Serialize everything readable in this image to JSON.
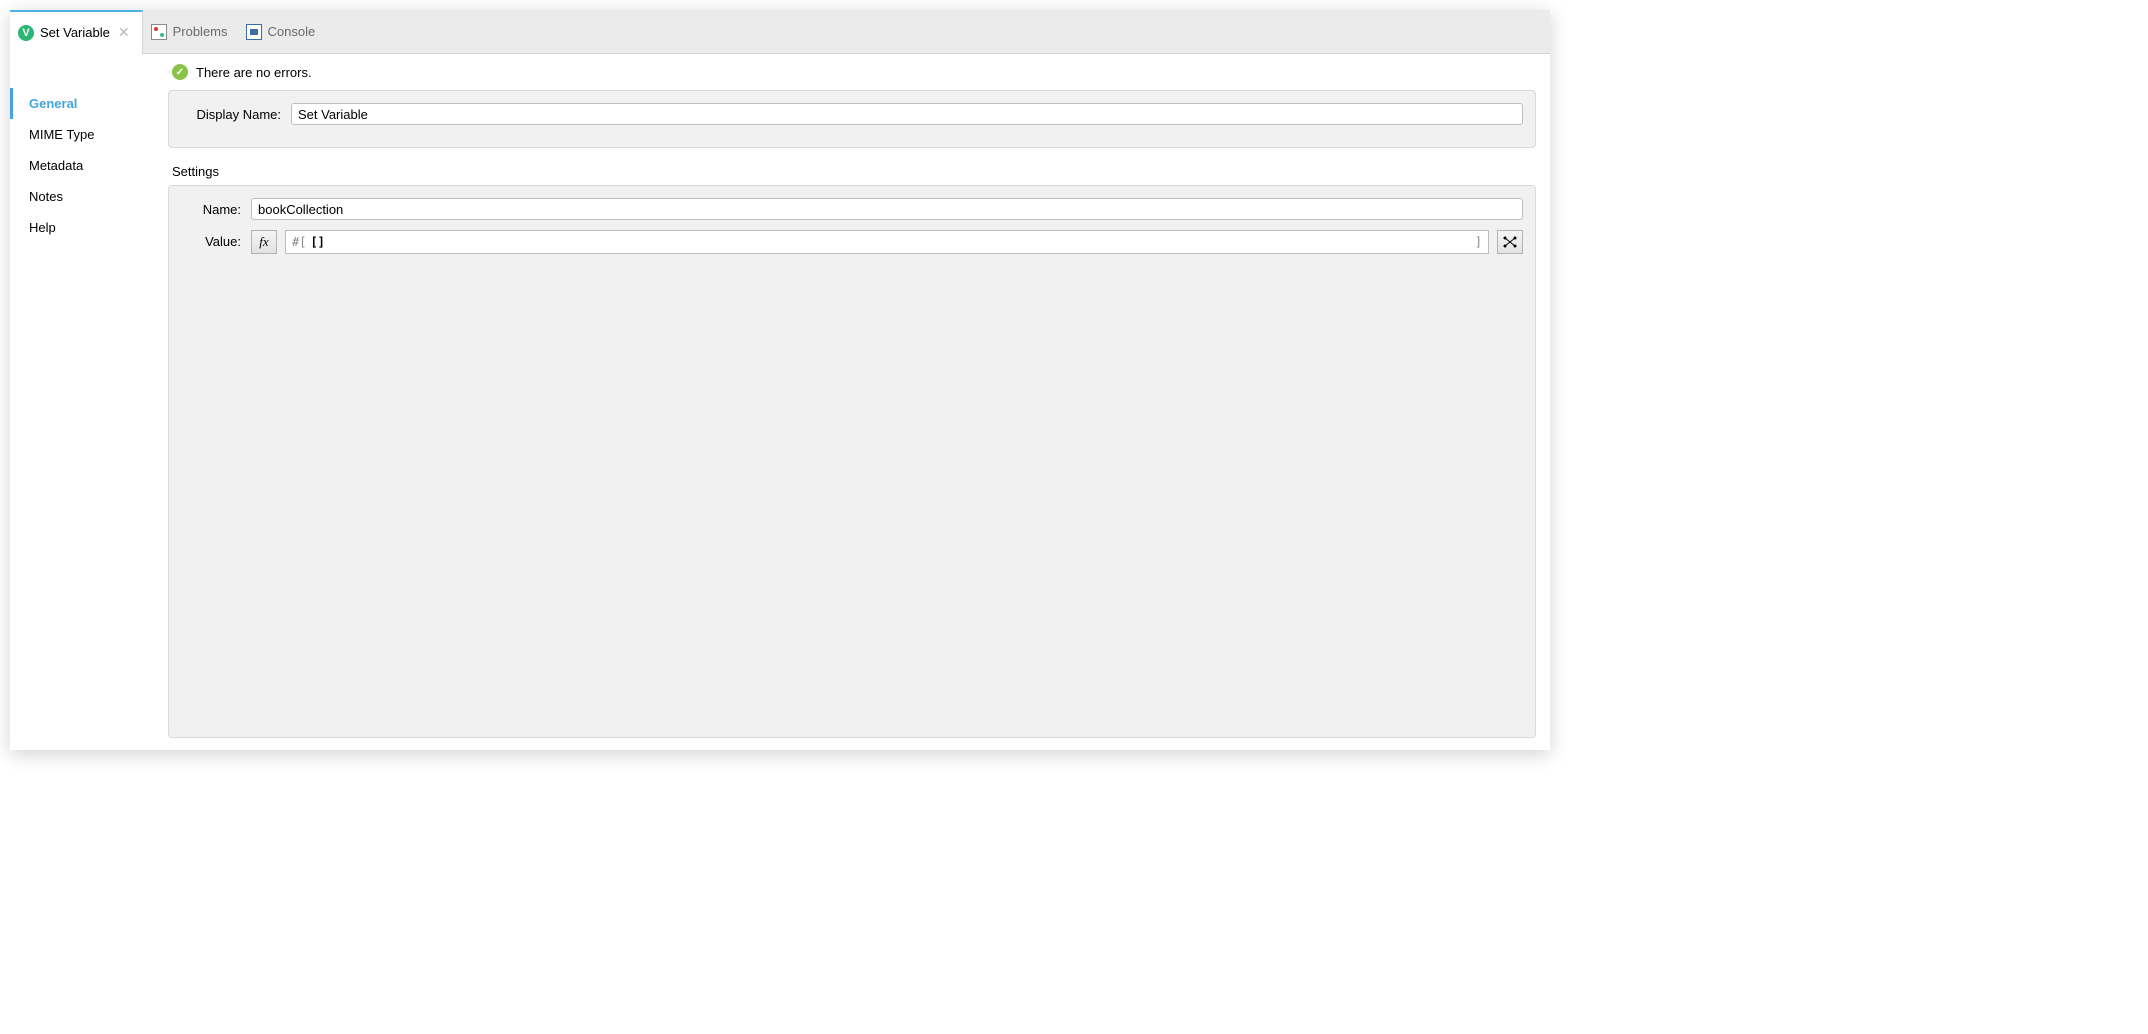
{
  "tabs": {
    "active": {
      "label": "Set Variable"
    },
    "problems": {
      "label": "Problems"
    },
    "console": {
      "label": "Console"
    }
  },
  "sidebar": {
    "items": [
      {
        "label": "General",
        "active": true
      },
      {
        "label": "MIME Type"
      },
      {
        "label": "Metadata"
      },
      {
        "label": "Notes"
      },
      {
        "label": "Help"
      }
    ]
  },
  "status": {
    "message": "There are no errors."
  },
  "form": {
    "display_name_label": "Display Name:",
    "display_name_value": "Set Variable",
    "settings_heading": "Settings",
    "name_label": "Name:",
    "name_value": "bookCollection",
    "value_label": "Value:",
    "fx_label": "fx",
    "expr_open": "#[",
    "expr_body": "[]",
    "expr_close": "]"
  }
}
